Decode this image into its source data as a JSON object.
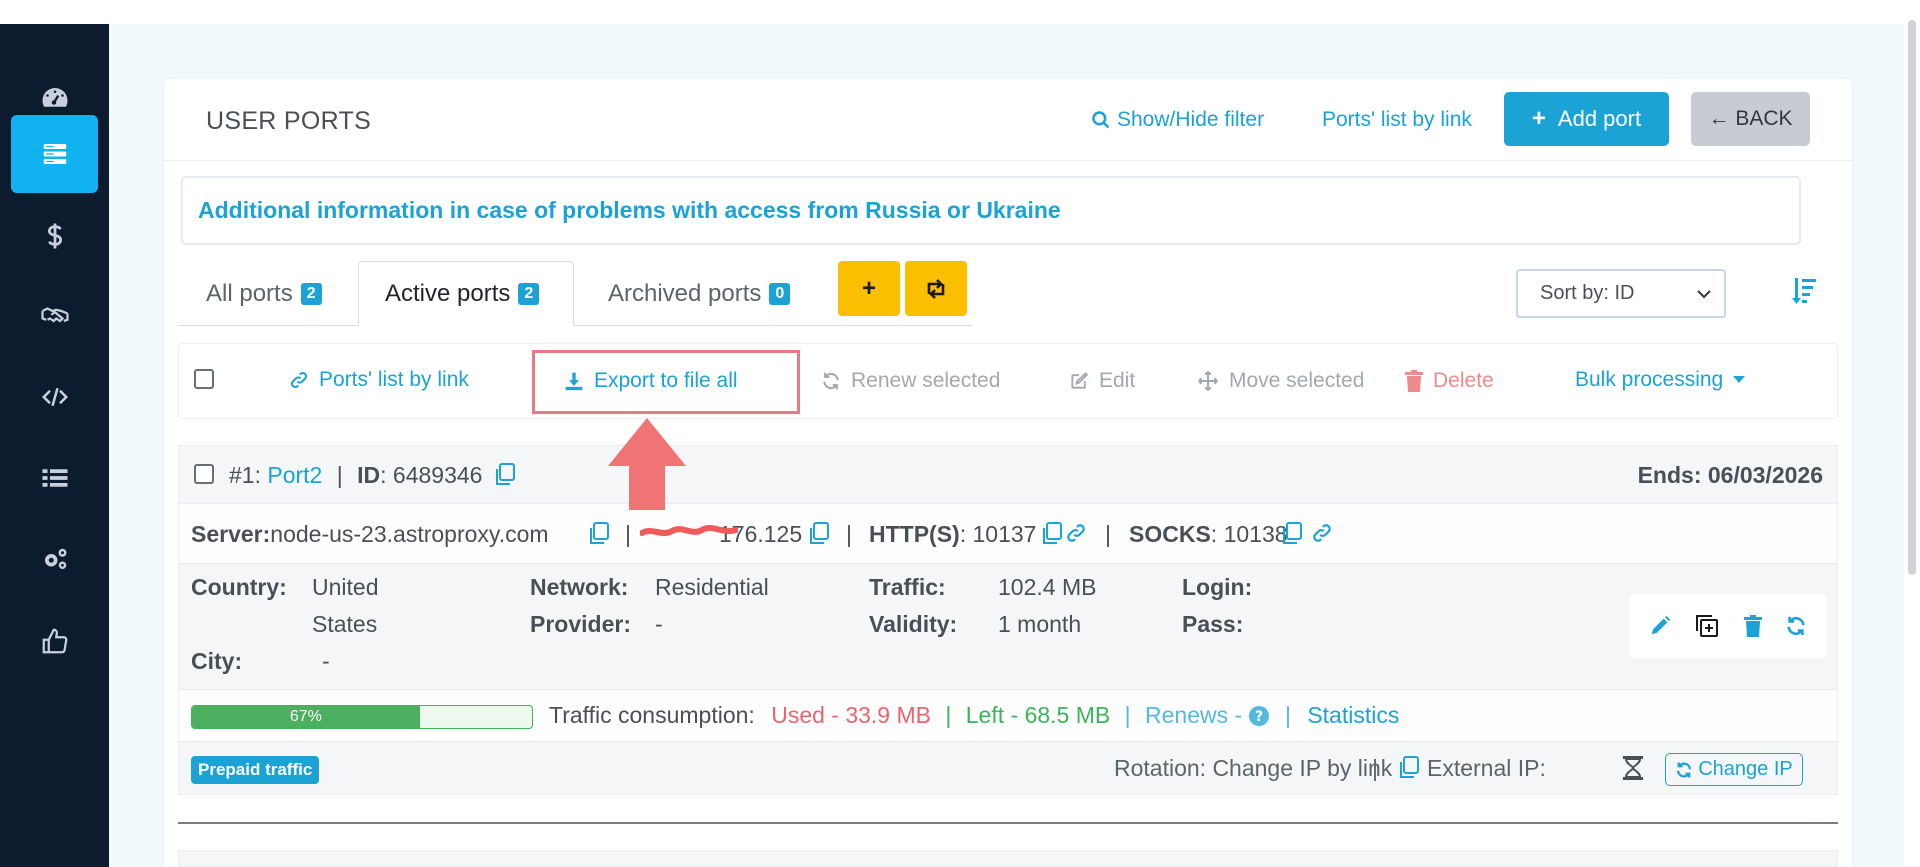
{
  "header": {
    "title": "USER PORTS",
    "show_hide_filter": "Show/Hide filter",
    "ports_list_by_link": "Ports' list by link",
    "add_port": "Add port",
    "back": "← BACK"
  },
  "info": {
    "text": "Additional information in case of problems with access from Russia or Ukraine"
  },
  "tabs": [
    {
      "label": "All ports",
      "count": "2"
    },
    {
      "label": "Active ports",
      "count": "2"
    },
    {
      "label": "Archived ports",
      "count": "0"
    }
  ],
  "sort": {
    "selected": "Sort by: ID"
  },
  "toolbar": {
    "ports_list_by_link": "Ports' list by link",
    "export": "Export to file all",
    "renew": "Renew selected",
    "edit": "Edit",
    "move": "Move selected",
    "delete": "Delete",
    "bulk": "Bulk processing"
  },
  "port": {
    "number": "#1:",
    "name": "Port2",
    "id_label": "ID",
    "id_value": ": 6489346",
    "ends": "Ends: 06/03/2026",
    "server_label": "Server:",
    "server_value": "node-us-23.astroproxy.com",
    "ip_tail": "176.125",
    "http_label": "HTTP(S)",
    "http_value": ": 10137",
    "socks_label": "SOCKS",
    "socks_value": ": 10138",
    "country_label": "Country:",
    "country_value_1": "United",
    "country_value_2": "States",
    "city_label": "City:",
    "city_value": "-",
    "network_label": "Network:",
    "network_value": "Residential",
    "provider_label": "Provider:",
    "provider_value": "-",
    "traffic_label": "Traffic:",
    "traffic_value": "102.4 MB",
    "validity_label": "Validity:",
    "validity_value": "1 month",
    "login_label": "Login:",
    "pass_label": "Pass:",
    "progress_percent": 67,
    "progress_label": "67%",
    "consumption_label": "Traffic consumption:",
    "used": "Used - 33.9 MB",
    "left": "Left - 68.5 MB",
    "renews": "Renews -",
    "statistics": "Statistics",
    "prepaid": "Prepaid traffic",
    "rotation": "Rotation: Change IP by link",
    "external_ip": "External IP:",
    "change_ip": "Change IP"
  },
  "colors": {
    "accent": "#1aa3d4",
    "sidebar": "#0d1b2e",
    "sidebar_active": "#11b2f0",
    "warning": "#f9bf00",
    "danger": "#e8656e",
    "success": "#3cb55a"
  }
}
